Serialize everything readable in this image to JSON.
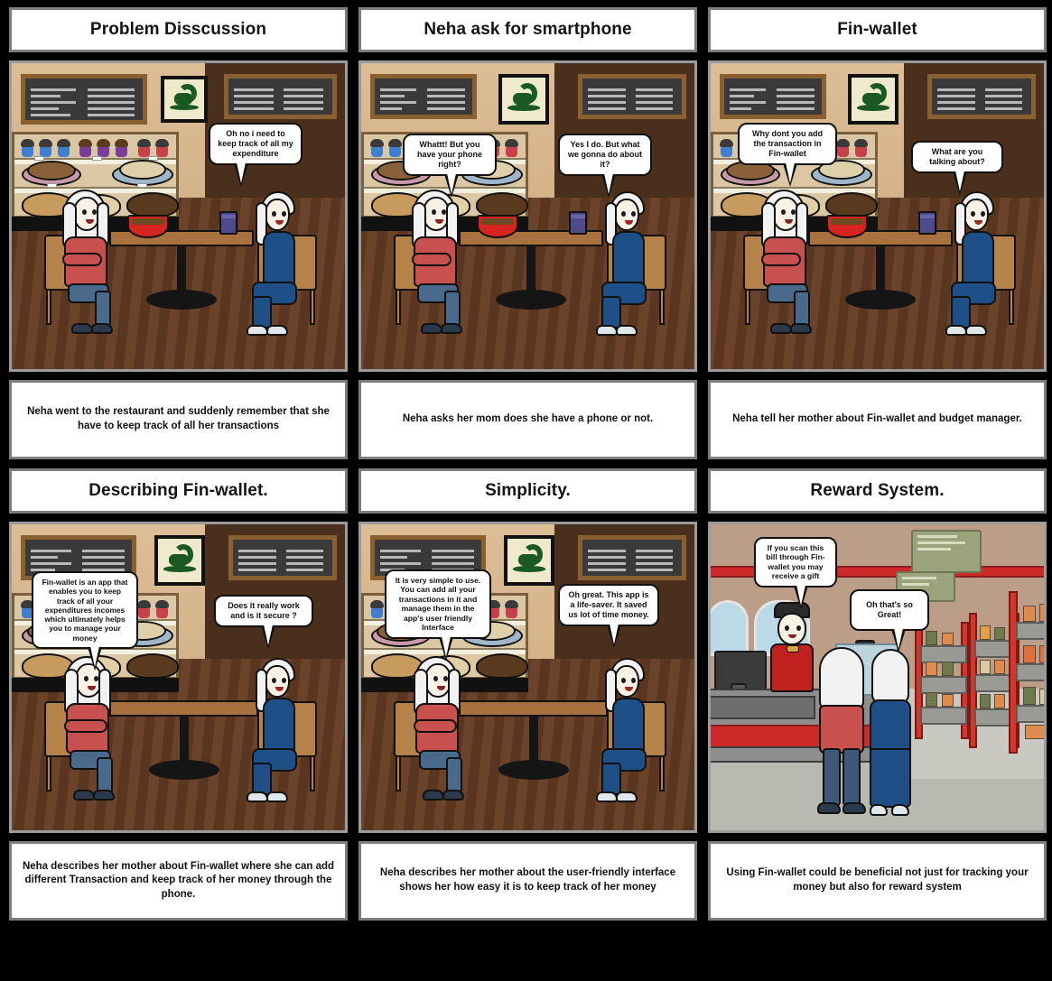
{
  "storyboard": {
    "panels": [
      {
        "id": "panel-1",
        "title": "Problem Disscussion",
        "scene": "cafe",
        "bubbles": [
          {
            "name": "bubble-neha-1",
            "text": "Oh no i need to keep track of all my expenditure"
          }
        ],
        "caption": "Neha went to the restaurant and suddenly remember that she have to keep track of all her transactions"
      },
      {
        "id": "panel-2",
        "title": "Neha ask for smartphone",
        "scene": "cafe",
        "bubbles": [
          {
            "name": "bubble-neha-2",
            "text": "Whattt! But you have your phone right?"
          },
          {
            "name": "bubble-mother-2",
            "text": "Yes I do. But what we gonna do about it?"
          }
        ],
        "caption": "Neha asks her mom does she have a phone or not."
      },
      {
        "id": "panel-3",
        "title": "Fin-wallet",
        "scene": "cafe",
        "bubbles": [
          {
            "name": "bubble-neha-3",
            "text": "Why dont you add the transaction in Fin-wallet"
          },
          {
            "name": "bubble-mother-3",
            "text": "What are you talking about?"
          }
        ],
        "caption": "Neha tell her mother about Fin-wallet and budget manager."
      },
      {
        "id": "panel-4",
        "title": "Describing Fin-wallet.",
        "scene": "cafe",
        "bubbles": [
          {
            "name": "bubble-neha-4",
            "text": "Fin-wallet is an app that enables you to keep track of all your expenditures incomes which ultimately helps you to manage your money"
          },
          {
            "name": "bubble-mother-4",
            "text": "Does it really work and is it secure ?"
          }
        ],
        "caption": "Neha describes her mother about Fin-wallet where she can add different Transaction and keep track of her money through the phone."
      },
      {
        "id": "panel-5",
        "title": "Simplicity.",
        "scene": "cafe",
        "bubbles": [
          {
            "name": "bubble-neha-5",
            "text": "It is very simple to use. You can add all your transactions in it and manage them in the app's user friendly Interface"
          },
          {
            "name": "bubble-mother-5",
            "text": "Oh great. This app is a life-saver. It saved us lot of time money."
          }
        ],
        "caption": "Neha describes her mother about the user-friendly interface shows her how easy it is to keep track of her money"
      },
      {
        "id": "panel-6",
        "title": "Reward System.",
        "scene": "supermarket",
        "bubbles": [
          {
            "name": "bubble-cashier-6",
            "text": "If you scan this bill through Fin-wallet you may receive a gift"
          },
          {
            "name": "bubble-mother-6",
            "text": "Oh that's so Great!"
          }
        ],
        "caption": "Using Fin-wallet could be beneficial not just for tracking your money but also for reward system"
      }
    ],
    "colors": {
      "background": "#000000",
      "card_background": "#ffffff",
      "card_border": "#7d7d7d",
      "panel_border": "#9b9b9b",
      "text": "#111111",
      "cafe_wall": "#d8b890",
      "cafe_floor": "#5a3620",
      "neha_top": "#c8504e",
      "neha_jeans": "#4a6a8c",
      "mother_dress": "#1f4f87",
      "cashier_uniform": "#c0211f",
      "market_stripe": "#cf2a2a",
      "bowl": "#d6241f",
      "cup": "#4e4a8c"
    }
  }
}
